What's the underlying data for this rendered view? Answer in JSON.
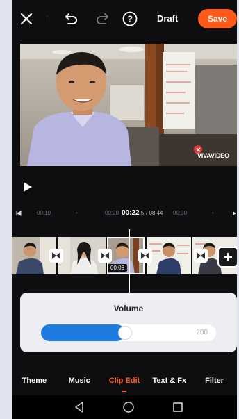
{
  "topbar": {
    "close_icon": "close-icon",
    "undo_icon": "undo-icon",
    "redo_icon": "redo-icon",
    "help_icon": "help-icon",
    "draft_label": "Draft",
    "save_label": "Save"
  },
  "video": {
    "watermark": "VIVAVIDEO",
    "play_icon": "play-icon"
  },
  "timeline": {
    "ticks": [
      "00:10",
      "00:20",
      "00:30"
    ],
    "current_time": "00:22",
    "current_time_fraction": ".5",
    "total_time": "/ 08:44",
    "selected_clip_duration": "00:06",
    "add_clip_icon": "plus-icon"
  },
  "volume": {
    "title": "Volume",
    "value_fraction": 0.48,
    "max_label": "200"
  },
  "tabs": [
    {
      "label": "Theme",
      "active": false
    },
    {
      "label": "Music",
      "active": false
    },
    {
      "label": "Clip Edit",
      "active": true
    },
    {
      "label": "Text & Fx",
      "active": false
    },
    {
      "label": "Filter",
      "active": false
    }
  ],
  "navbar": {
    "back_icon": "back-triangle-icon",
    "home_icon": "home-circle-icon",
    "recents_icon": "recents-square-icon"
  },
  "colors": {
    "accent": "#ff5a1a",
    "volume_fill": "#1e7be0",
    "background": "#0e0e10"
  }
}
